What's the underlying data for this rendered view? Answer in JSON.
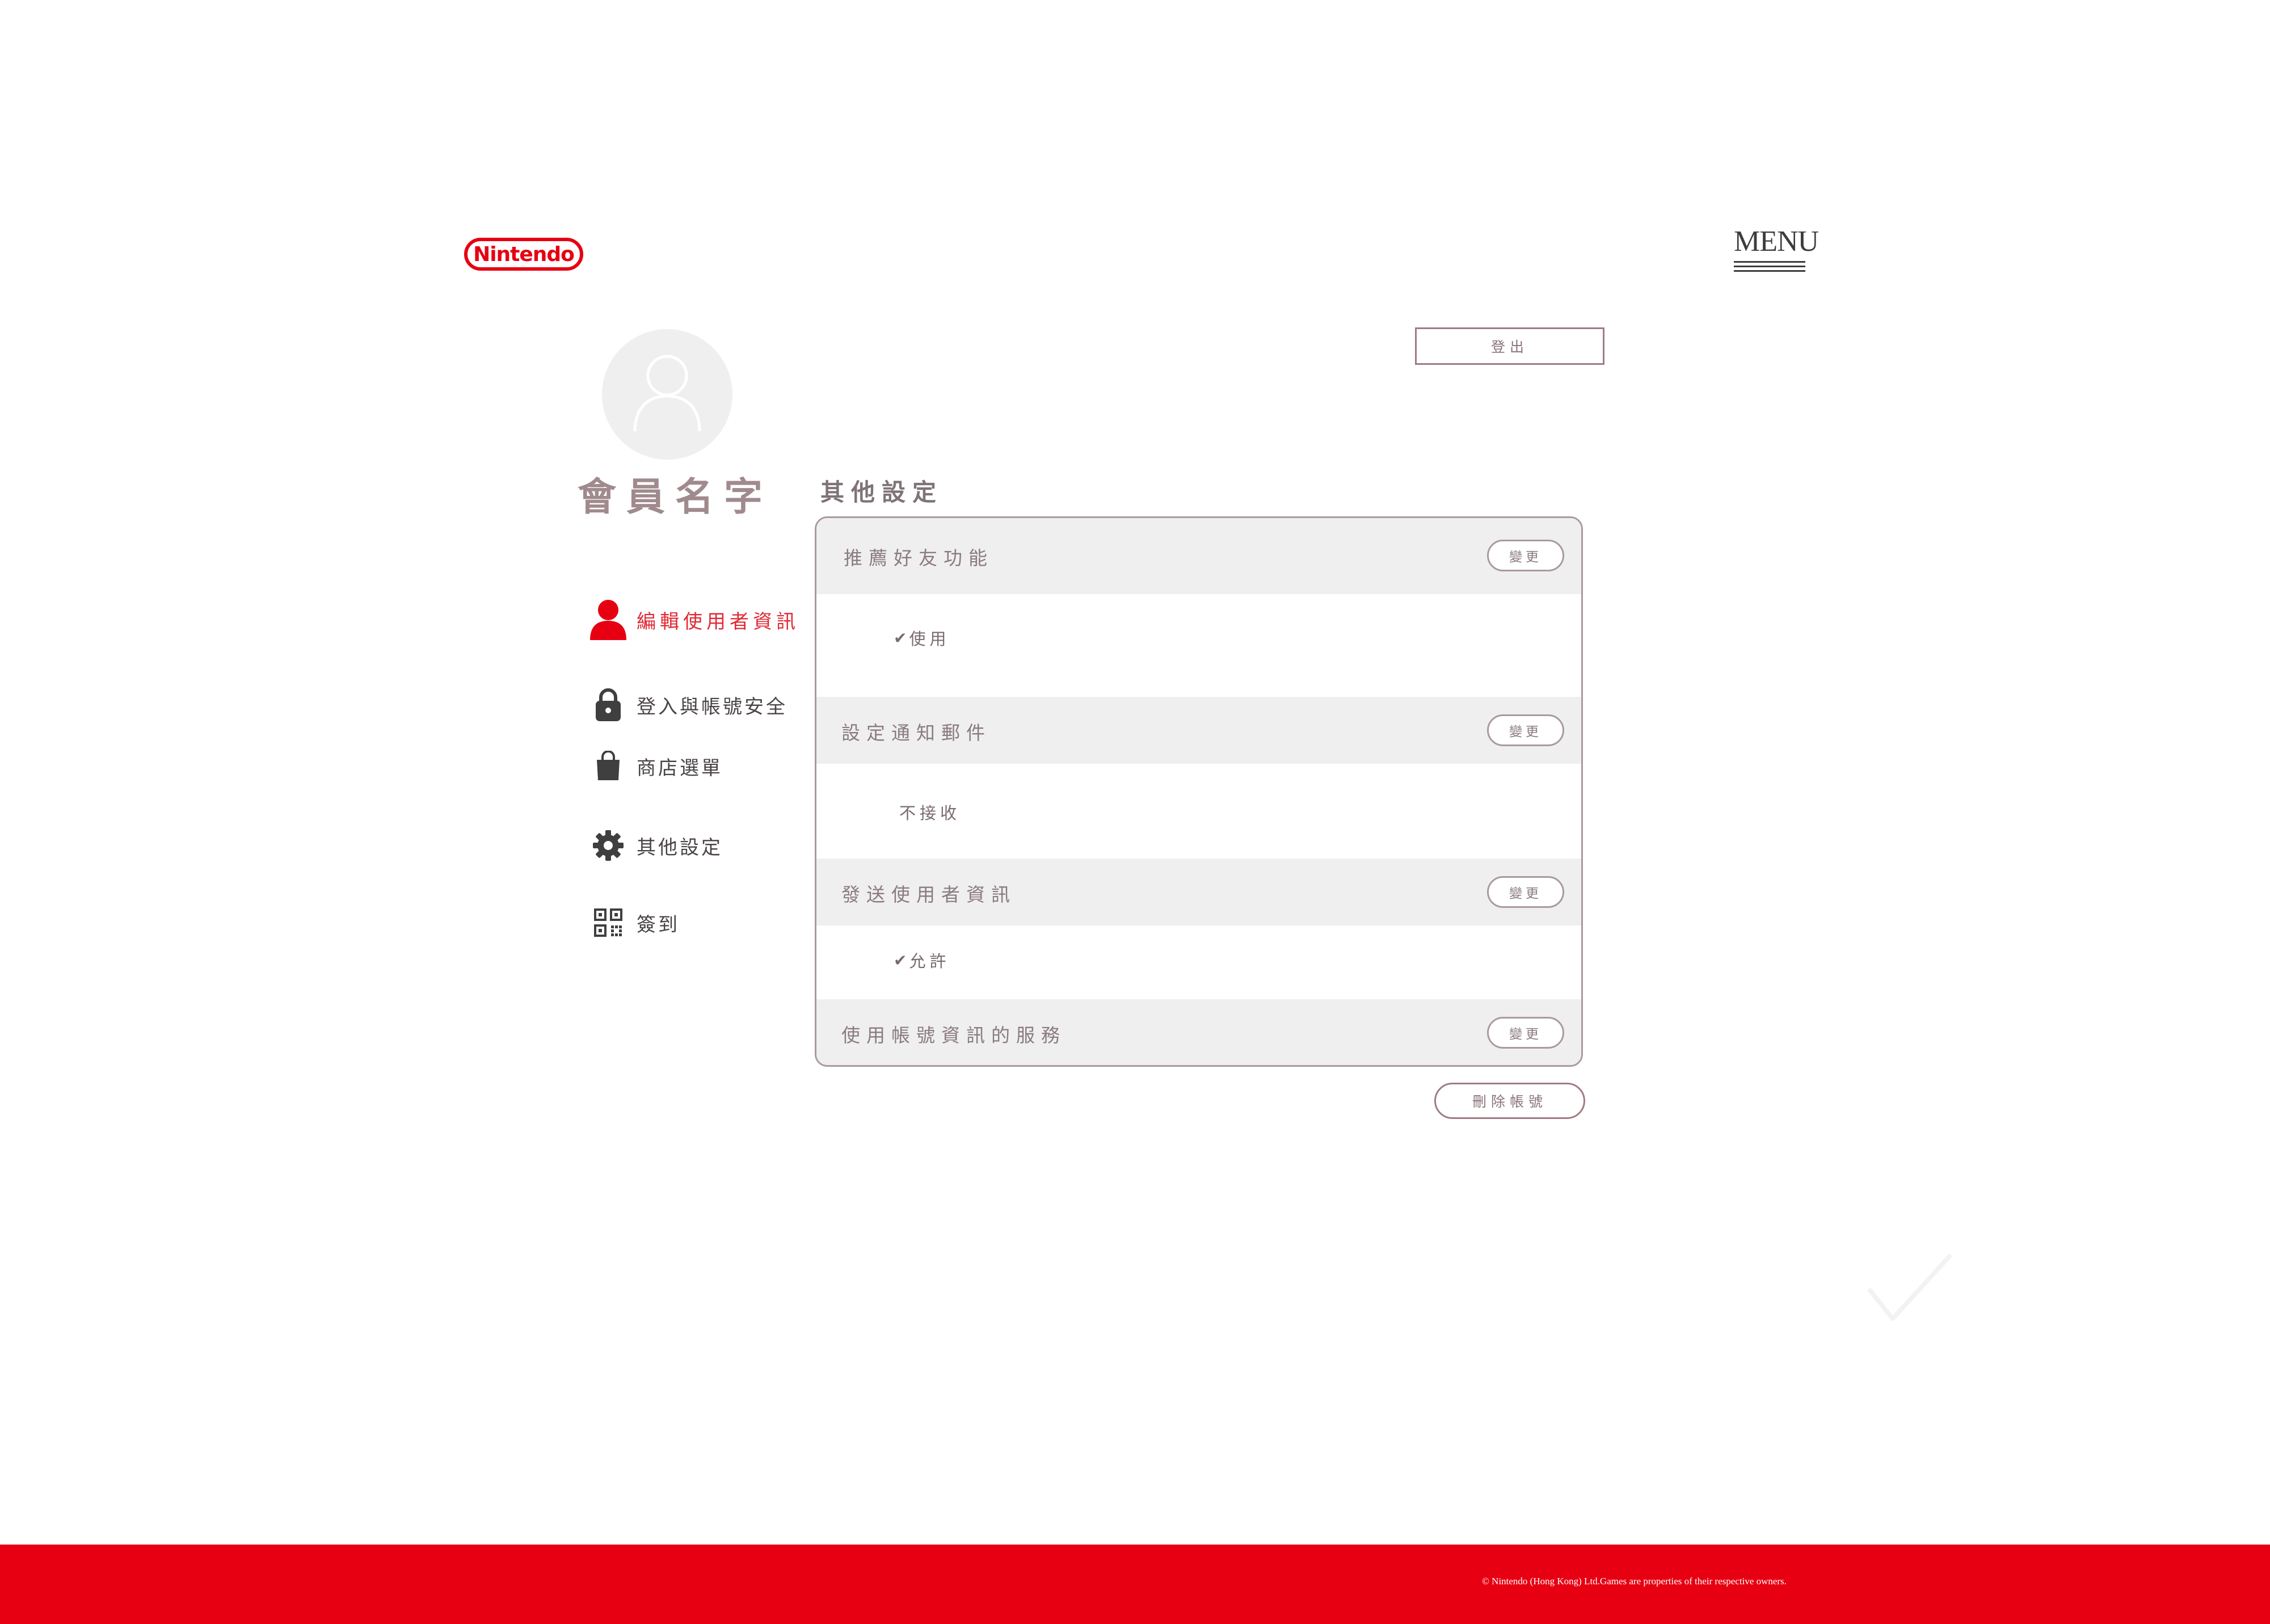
{
  "header": {
    "logo_text": "Nintendo",
    "menu_label": "MENU"
  },
  "profile": {
    "member_name": "會員名字",
    "logout_label": "登出"
  },
  "sidebar": {
    "items": [
      {
        "label": "編輯使用者資訊",
        "icon": "user-icon",
        "active": true
      },
      {
        "label": "登入與帳號安全",
        "icon": "lock-icon",
        "active": false
      },
      {
        "label": "商店選單",
        "icon": "shopping-bag-icon",
        "active": false
      },
      {
        "label": "其他設定",
        "icon": "gear-icon",
        "active": false
      },
      {
        "label": "簽到",
        "icon": "qr-code-icon",
        "active": false
      }
    ]
  },
  "main": {
    "section_title": "其他設定",
    "settings": [
      {
        "title": "推薦好友功能",
        "value": "使用",
        "checked": true,
        "button": "變更"
      },
      {
        "title": "設定通知郵件",
        "value": "不接收",
        "checked": false,
        "button": "變更"
      },
      {
        "title": "發送使用者資訊",
        "value": "允許",
        "checked": true,
        "button": "變更"
      },
      {
        "title": "使用帳號資訊的服務",
        "button": "變更"
      }
    ],
    "delete_label": "刪除帳號"
  },
  "footer": {
    "copyright": "© Nintendo (Hong Kong) Ltd.Games are properties of their respective owners."
  },
  "colors": {
    "brand_red": "#e60012",
    "active_red": "#e02a35",
    "panel_border": "#a99a9d",
    "row_bg": "#efefef"
  }
}
